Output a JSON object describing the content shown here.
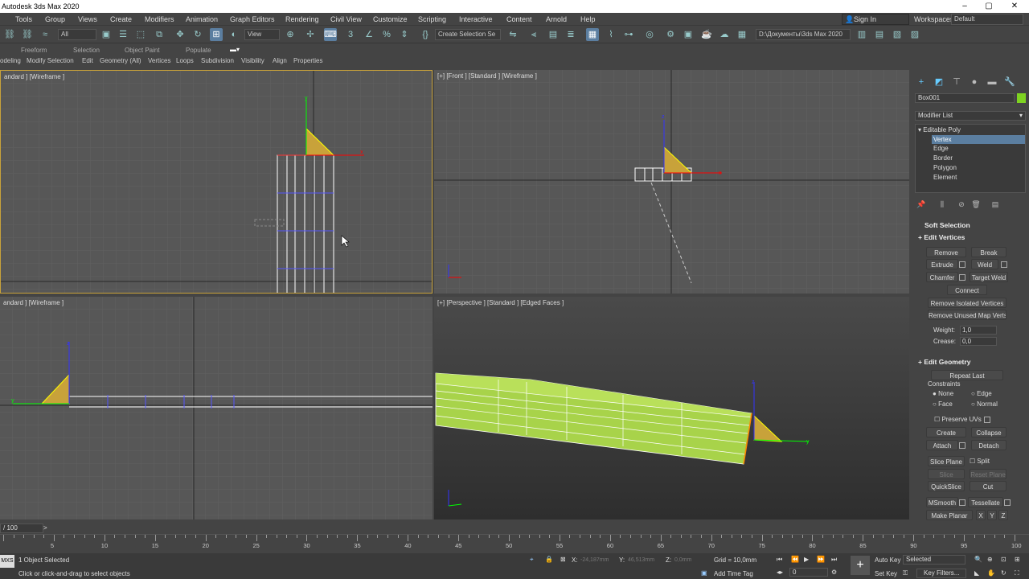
{
  "window": {
    "title": "Autodesk 3ds Max 2020",
    "controls": [
      "–",
      "▢",
      "✕"
    ]
  },
  "menu": [
    "Tools",
    "Group",
    "Views",
    "Create",
    "Modifiers",
    "Animation",
    "Graph Editors",
    "Rendering",
    "Civil View",
    "Customize",
    "Scripting",
    "Interactive",
    "Content",
    "Arnold",
    "Help"
  ],
  "signin": "Sign In",
  "workspaces": {
    "label": "Workspaces:",
    "value": "Default"
  },
  "toolbar": {
    "filter_value": "All",
    "refcoord_value": "View",
    "selection_set": "Create Selection Se",
    "project_path": "D:\\Документы\\3ds Max 2020"
  },
  "ribbon": {
    "tabs": [
      "Freeform",
      "Selection",
      "Object Paint",
      "Populate"
    ],
    "subtabs": [
      "odeling",
      "Modify Selection",
      "Edit",
      "Geometry (All)",
      "Vertices",
      "Loops",
      "Subdivision",
      "Visibility",
      "Align",
      "Properties"
    ]
  },
  "viewports": {
    "top_left": "andard ] [Wireframe ]",
    "top_right": "[+] [Front ] [Standard ] [Wireframe ]",
    "bottom_left": "andard ] [Wireframe ]",
    "bottom_right": "[+] [Perspective ] [Standard ] [Edged Faces ]"
  },
  "command_panel": {
    "object_name": "Box001",
    "modifier_list": "Modifier List",
    "stack": [
      "Editable Poly",
      "Vertex",
      "Edge",
      "Border",
      "Polygon",
      "Element"
    ],
    "selected_level": "Vertex",
    "object_color": "#7ed321",
    "soft_selection": "Soft Selection",
    "edit_vertices": {
      "title": "Edit Vertices",
      "buttons": [
        "Remove",
        "Break",
        "Extrude",
        "Weld",
        "Chamfer",
        "Target Weld",
        "Connect",
        "Remove Isolated Vertices",
        "Remove Unused Map Verts"
      ],
      "weight_label": "Weight:",
      "weight_value": "1,0",
      "crease_label": "Crease:",
      "crease_value": "0,0"
    },
    "edit_geometry": {
      "title": "Edit Geometry",
      "repeat_last": "Repeat Last",
      "constraints_label": "Constraints",
      "constraints": [
        "None",
        "Edge",
        "Face",
        "Normal"
      ],
      "constraint_selected": "None",
      "preserve_uvs": "Preserve UVs",
      "buttons": [
        "Create",
        "Collapse",
        "Attach",
        "Detach",
        "Slice Plane",
        "Split",
        "Slice",
        "Reset Plane",
        "QuickSlice",
        "Cut",
        "MSmooth",
        "Tessellate",
        "Make Planar",
        "X",
        "Y",
        "Z"
      ]
    }
  },
  "timeline": {
    "frame": "/ 100",
    "ticks": [
      "5",
      "10",
      "15",
      "20",
      "25",
      "30",
      "35",
      "40",
      "45",
      "50",
      "55",
      "60",
      "65",
      "70",
      "75",
      "80",
      "85",
      "90",
      "95",
      "100"
    ]
  },
  "status": {
    "selected": "1 Object Selected",
    "prompt": "Click or click-and-drag to select objects",
    "x_label": "X:",
    "x_value": "-24,187mm",
    "y_label": "Y:",
    "y_value": "46,513mm",
    "z_label": "Z:",
    "z_value": "0,0mm",
    "grid": "Grid = 10,0mm",
    "add_time_tag": "Add Time Tag",
    "auto_key": "Auto Key",
    "set_key": "Set Key",
    "key_mode": "Selected",
    "key_filters": "Key Filters...",
    "frame_value": "0"
  }
}
